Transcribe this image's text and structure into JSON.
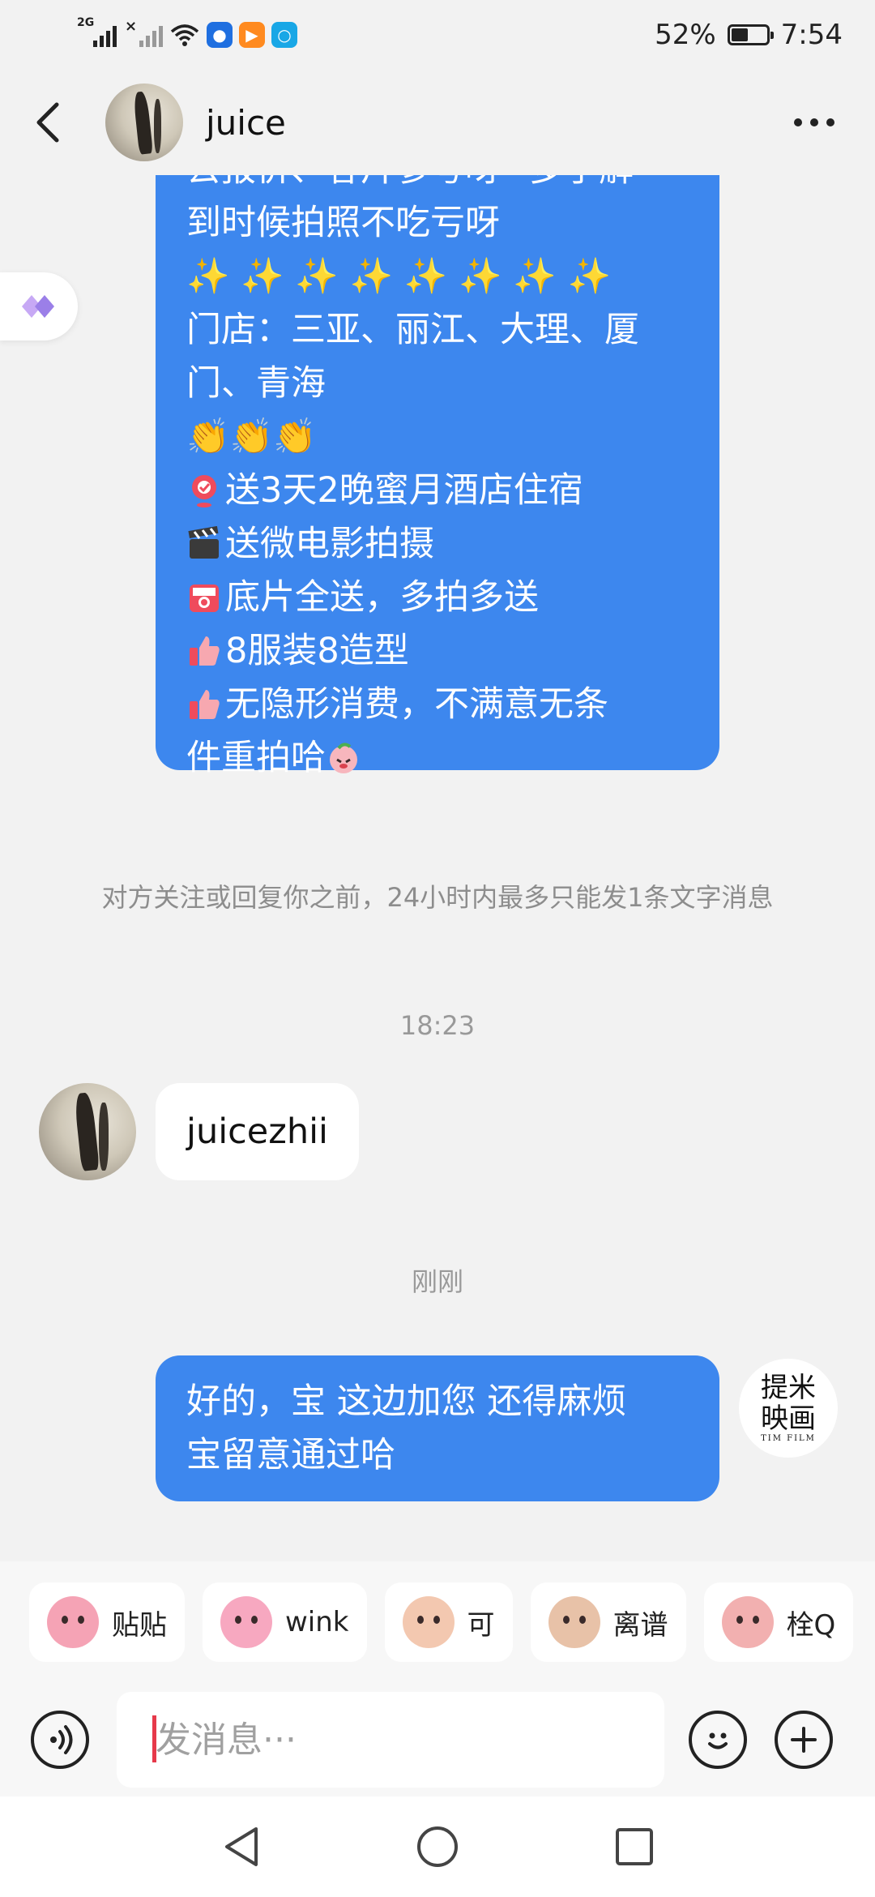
{
  "status_bar": {
    "network_label": "2G",
    "battery_percent": "52%",
    "battery_level": 0.52,
    "time": "7:54",
    "icons": [
      "signal-icon",
      "signal-no-service-icon",
      "wifi-icon",
      "app-notification-icon",
      "video-app-icon",
      "search-app-icon"
    ]
  },
  "header": {
    "contact_name": "juice"
  },
  "chat": {
    "outgoing_message_1": {
      "lines": [
        "去报价、客片参考呀~多了解",
        "到时候拍照不吃亏呀",
        "✨ ✨ ✨ ✨ ✨ ✨ ✨ ✨",
        "门店：三亚、丽江、大理、厦",
        "门、青海",
        "👏👏👏",
        "送3天2晚蜜月酒店住宿",
        "送微电影拍摄",
        "底片全送，多拍多送",
        "8服装8造型",
        "无隐形消费，不满意无条",
        "件重拍哈"
      ]
    },
    "notice": "对方关注或回复你之前，24小时内最多只能发1条文字消息",
    "time_1": "18:23",
    "incoming_message": "juicezhii",
    "time_2": "刚刚",
    "outgoing_message_2": {
      "lines": [
        "好的，宝 这边加您 还得麻烦",
        "宝留意通过哈"
      ]
    },
    "self_avatar_text": [
      "提米",
      "映画"
    ],
    "self_avatar_small": "TIM FILM"
  },
  "stickers": [
    {
      "label": "贴贴",
      "color": "#f5a3b5"
    },
    {
      "label": "wink",
      "color": "#f7a8c0"
    },
    {
      "label": "可",
      "color": "#f3c8b0"
    },
    {
      "label": "离谱",
      "color": "#e8c2a8"
    },
    {
      "label": "栓Q",
      "color": "#f2b0b0"
    }
  ],
  "input": {
    "placeholder": "发消息···"
  },
  "colors": {
    "accent_blue": "#3d87ee",
    "caret_red": "#e6394a"
  }
}
